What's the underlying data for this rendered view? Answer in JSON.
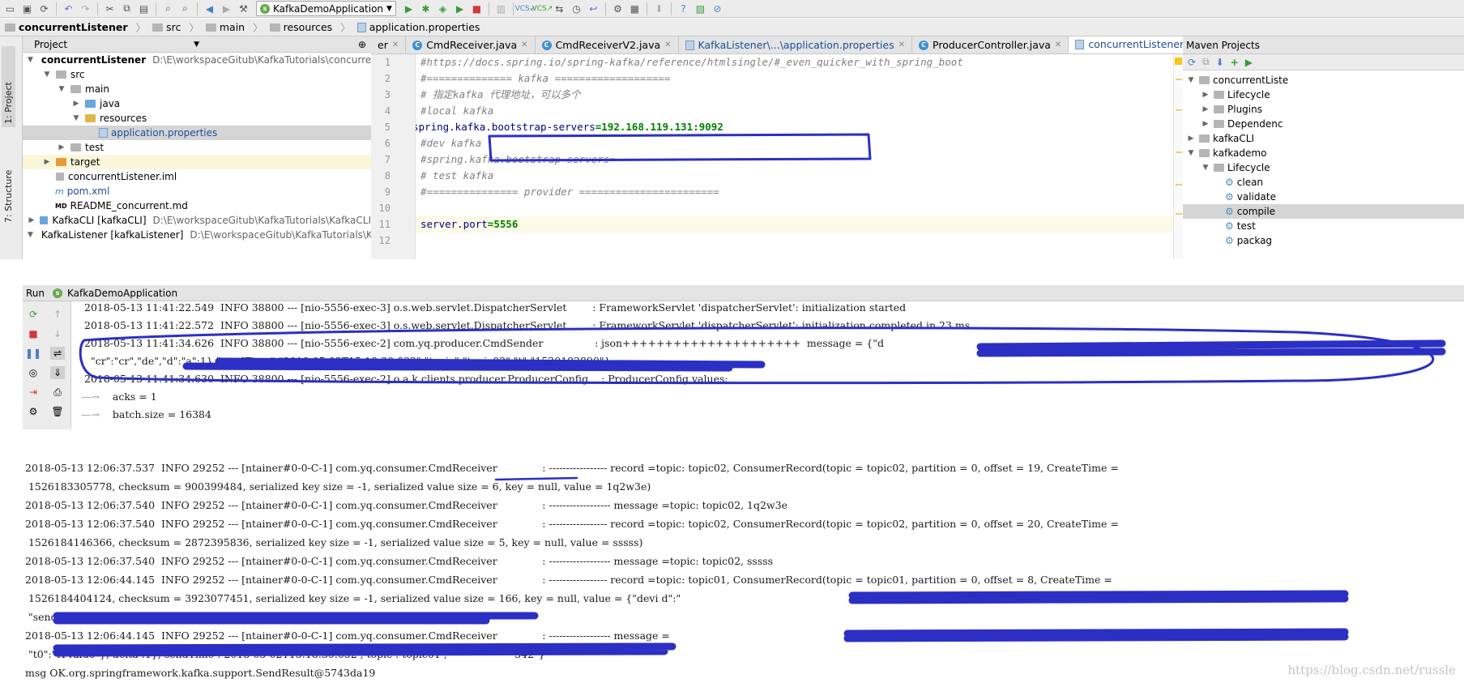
{
  "toolbar": {
    "run_config": "KafkaDemoApplication",
    "icons": [
      "open-icon",
      "save-icon",
      "sync-icon",
      "undo-icon",
      "redo-icon",
      "cut-icon",
      "copy-icon",
      "paste-icon",
      "find-icon",
      "replace-icon",
      "back-icon",
      "forward-icon",
      "build-icon",
      "run-icon",
      "debug-icon",
      "coverage-icon",
      "stop-icon",
      "vcs-update-icon",
      "vcs-commit-icon",
      "help-icon"
    ]
  },
  "breadcrumb": [
    "concurrentListener",
    "src",
    "main",
    "resources",
    "application.properties"
  ],
  "left_strip": {
    "project_tab": "1: Project",
    "structure_tab": "7: Structure"
  },
  "project": {
    "header": "Project",
    "tree": [
      {
        "label": "concurrentListener",
        "path": "D:\\E\\workspaceGitub\\KafkaTutorials\\concurrentListener",
        "bold": true
      },
      {
        "label": "src"
      },
      {
        "label": "main"
      },
      {
        "label": "java"
      },
      {
        "label": "resources"
      },
      {
        "label": "application.properties"
      },
      {
        "label": "test"
      },
      {
        "label": "target"
      },
      {
        "label": "concurrentListener.iml"
      },
      {
        "label": "pom.xml"
      },
      {
        "label": "README_concurrent.md"
      },
      {
        "label": "KafkaCLI [kafkaCLI]",
        "path": "D:\\E\\workspaceGitub\\KafkaTutorials\\KafkaCLI"
      },
      {
        "label": "KafkaListener [kafkaListener]",
        "path": "D:\\E\\workspaceGitub\\KafkaTutorials\\KafkaListe"
      }
    ]
  },
  "tabs": [
    {
      "label": "er",
      "active": false
    },
    {
      "label": "CmdReceiver.java",
      "active": false
    },
    {
      "label": "CmdReceiverV2.java",
      "active": false
    },
    {
      "label": "KafkaListener\\...\\application.properties",
      "active": false
    },
    {
      "label": "ProducerController.java",
      "active": false
    },
    {
      "label": "concurrentListener\\...\\application.properties",
      "active": true
    }
  ],
  "tab_overflow": "≡5",
  "editor": {
    "line_numbers": [
      "1",
      "2",
      "3",
      "4",
      "5",
      "6",
      "7",
      "8",
      "9",
      "10",
      "11",
      "12"
    ],
    "lines": {
      "l1": "#https://docs.spring.io/spring-kafka/reference/htmlsingle/#_even_quicker_with_spring_boot",
      "l2": "#============== kafka ===================",
      "l3": "# 指定kafka 代理地址，可以多个",
      "l4": "#local kafka",
      "l5_key": "spring.kafka.bootstrap-servers",
      "l5_val": "=192.168.119.131:9092",
      "l6": "#dev kafka",
      "l7": "#spring.kafka.bootstrap-servers=",
      "l8": "# test kafka",
      "l9": "#=============== provider =======================",
      "l11_key": "server.port",
      "l11_val": "=5556"
    }
  },
  "maven": {
    "header": "Maven Projects",
    "tree": [
      "concurrentListe",
      "Lifecycle",
      "Plugins",
      "Dependenc",
      "kafkaCLI",
      "kafkademo",
      "Lifecycle",
      "clean",
      "validate",
      "compile",
      "test",
      "packag"
    ]
  },
  "run": {
    "header": "Run",
    "config": "KafkaDemoApplication",
    "lines": [
      "2018-05-13 11:41:22.549  INFO 38800 --- [nio-5556-exec-3] o.s.web.servlet.DispatcherServlet        : FrameworkServlet 'dispatcherServlet': initialization started",
      "2018-05-13 11:41:22.572  INFO 38800 --- [nio-5556-exec-3] o.s.web.servlet.DispatcherServlet        : FrameworkServlet 'dispatcherServlet': initialization completed in 23 ms",
      "2018-05-13 11:41:34.626  INFO 38800 --- [nio-5556-exec-2] com.yq.producer.CmdSender                : json+++++++++++++++++++++  message = {\"d",
      "  \"cr\":\"cr\",\"de\",\"d\":\"a\":1},\"sendTime\":\"2018-05-02T15:18:30.032\",\"topic\":\"topic02\",\"t\":\"1520182890\"}",
      "2018-05-13 11:41:34.630  INFO 38800 --- [nio-5556-exec-2] o.a.k.clients.producer.ProducerConfig    : ProducerConfig values:",
      "    acks = 1",
      "    batch.size = 16384"
    ]
  },
  "consumer": {
    "lines": [
      "2018-05-13 12:06:37.537  INFO 29252 --- [ntainer#0-0-C-1] com.yq.consumer.CmdReceiver              : ----------------- record =topic: topic02, ConsumerRecord(topic = topic02, partition = 0, offset = 19, CreateTime =",
      " 1526183305778, checksum = 900399484, serialized key size = -1, serialized value size = 6, key = null, value = 1q2w3e)",
      "2018-05-13 12:06:37.540  INFO 29252 --- [ntainer#0-0-C-1] com.yq.consumer.CmdReceiver              : ------------------ message =topic: topic02, 1q2w3e",
      "2018-05-13 12:06:37.540  INFO 29252 --- [ntainer#0-0-C-1] com.yq.consumer.CmdReceiver              : ----------------- record =topic: topic02, ConsumerRecord(topic = topic02, partition = 0, offset = 20, CreateTime =",
      " 1526184146366, checksum = 2872395836, serialized key size = -1, serialized value size = 5, key = null, value = sssss)",
      "2018-05-13 12:06:37.540  INFO 29252 --- [ntainer#0-0-C-1] com.yq.consumer.CmdReceiver              : ------------------ message =topic: topic02, sssss",
      "2018-05-13 12:06:44.145  INFO 29252 --- [ntainer#0-0-C-1] com.yq.consumer.CmdReceiver              : ----------------- record =topic: topic01, ConsumerRecord(topic = topic01, partition = 0, offset = 8, CreateTime =",
      " 1526184404124, checksum = 3923077451, serialized key size = -1, serialized value size = 166, key = null, value = {\"devi d\":\"",
      " \"sendTime\":\"2018-05-02T15:18:30.032\",\"topic\":\"topic01\",\"t\":\"1520182890342\"})",
      "2018-05-13 12:06:44.145  INFO 29252 --- [ntainer#0-0-C-1] com.yq.consumer.CmdReceiver              : ------------------ message =                                                                  alue\",",
      " \"t0\":\"t1Value\"}, delta :1}, sendTime : 2018-05-02T15:18:30.032 , topic : topic01 ,                     342\"}",
      "msg OK.org.springframework.kafka.support.SendResult@5743da19"
    ]
  },
  "watermark": "https://blog.csdn.net/russle",
  "colors": {
    "annotation": "#2c2fc4",
    "value_green": "#008000",
    "key_navy": "#000080",
    "comment_grey": "#808080"
  }
}
